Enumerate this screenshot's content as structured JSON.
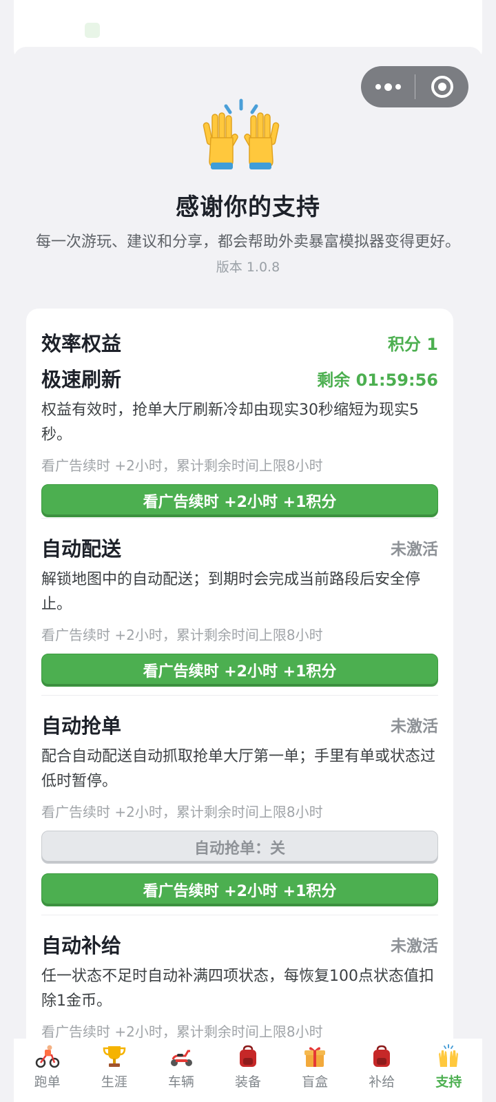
{
  "capsule": {
    "more_icon": "more-dots-icon",
    "close_icon": "target-close-icon"
  },
  "hero": {
    "icon": "raised-hands-icon",
    "title": "感谢你的支持",
    "subtitle": "每一次游玩、建议和分享，都会帮助外卖暴富模拟器变得更好。",
    "version": "版本 1.0.8"
  },
  "card": {
    "heading": "效率权益",
    "points": "积分 1",
    "sections": [
      {
        "title": "极速刷新",
        "status": "剩余 01:59:56",
        "desc": "权益有效时，抢单大厅刷新冷却由现实30秒缩短为现实5秒。",
        "note": "看广告续时 +2小时，累计剩余时间上限8小时",
        "button": "看广告续时 +2小时 +1积分"
      },
      {
        "title": "自动配送",
        "status": "未激活",
        "desc": "解锁地图中的自动配送；到期时会完成当前路段后安全停止。",
        "note": "看广告续时 +2小时，累计剩余时间上限8小时",
        "button": "看广告续时 +2小时 +1积分"
      },
      {
        "title": "自动抢单",
        "status": "未激活",
        "desc": "配合自动配送自动抓取抢单大厅第一单；手里有单或状态过低时暂停。",
        "note": "看广告续时 +2小时，累计剩余时间上限8小时",
        "toggle": "自动抢单：关",
        "button": "看广告续时 +2小时 +1积分"
      },
      {
        "title": "自动补给",
        "status": "未激活",
        "desc": "任一状态不足时自动补满四项状态，每恢复100点状态值扣除1金币。",
        "note": "看广告续时 +2小时，累计剩余时间上限8小时"
      }
    ]
  },
  "tabs": [
    {
      "label": "跑单",
      "icon": "cyclist-icon"
    },
    {
      "label": "生涯",
      "icon": "trophy-icon"
    },
    {
      "label": "车辆",
      "icon": "scooter-icon"
    },
    {
      "label": "装备",
      "icon": "backpack-icon"
    },
    {
      "label": "盲盒",
      "icon": "gift-box-icon"
    },
    {
      "label": "补给",
      "icon": "backpack-icon"
    },
    {
      "label": "支持",
      "icon": "raised-hands-icon",
      "active": true
    }
  ],
  "colors": {
    "accent": "#4caf50",
    "background": "#f2f2f5",
    "inactive_text": "#8e9297"
  }
}
